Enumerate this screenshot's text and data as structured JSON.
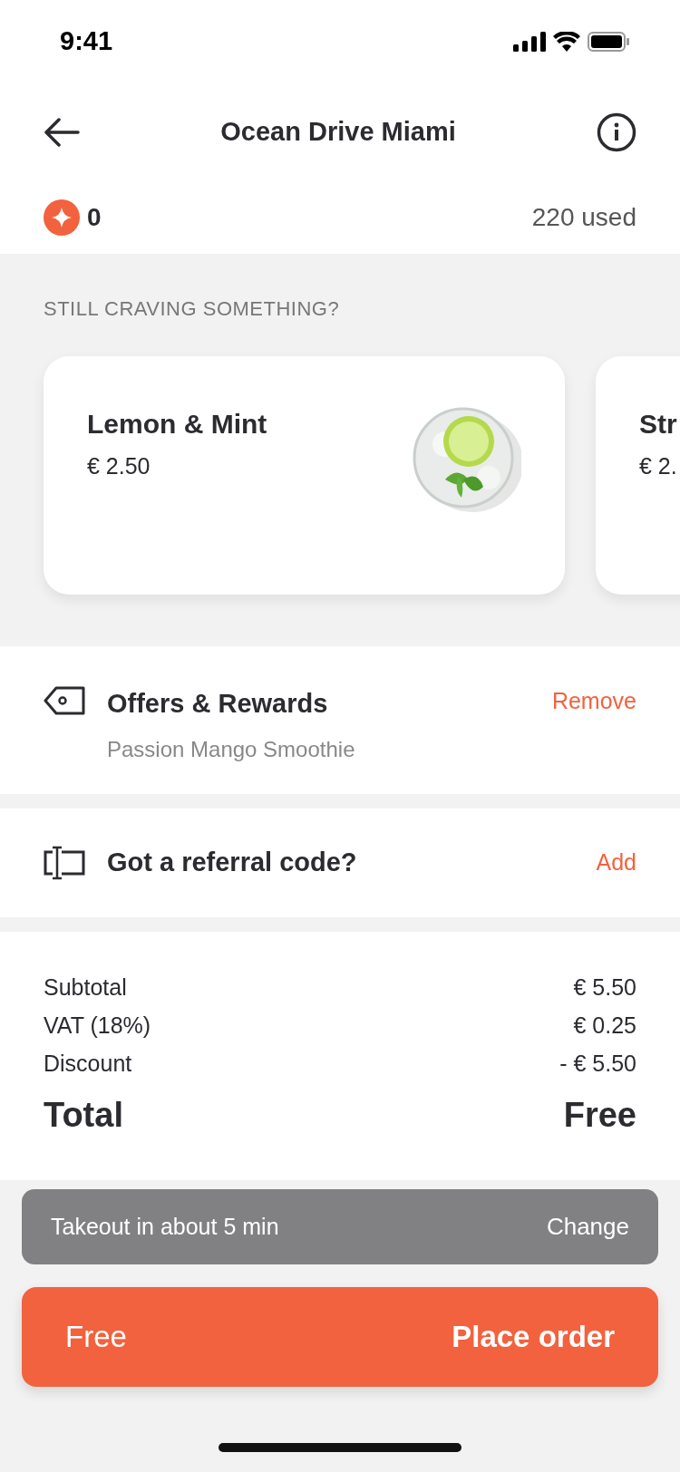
{
  "status_bar": {
    "time": "9:41"
  },
  "header": {
    "title": "Ocean Drive Miami"
  },
  "points": {
    "balance": "0",
    "used": "220 used"
  },
  "suggestions": {
    "heading": "STILL CRAVING SOMETHING?",
    "items": [
      {
        "name": "Lemon & Mint",
        "price": "€ 2.50",
        "kind": "picture"
      },
      {
        "name": "Str",
        "price": "€ 2."
      }
    ]
  },
  "rows": [
    {
      "kind": "tag",
      "title": "Offers & Rewards",
      "subtitle": "Passion Mango Smoothie",
      "action": "Remove"
    },
    {
      "kind": "code",
      "title": "Got a referral code?",
      "action": "Add"
    }
  ],
  "summary": {
    "lines": [
      {
        "label": "Subtotal",
        "value": "€ 5.50"
      },
      {
        "label": "VAT (18%)",
        "value": "€ 0.25"
      },
      {
        "label": "Discount",
        "value": "- € 5.50"
      }
    ],
    "total_label": "Total",
    "total_value": "Free"
  },
  "pickup": {
    "text": "Takeout in about 5 min",
    "action": "Change"
  },
  "order_button": {
    "price": "Free",
    "label": "Place order"
  }
}
